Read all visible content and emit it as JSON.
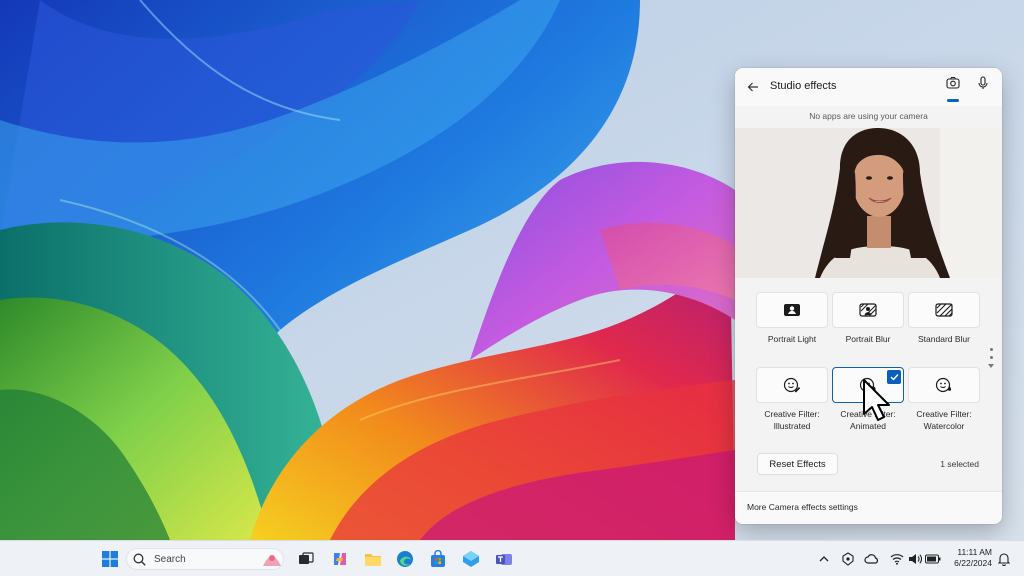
{
  "flyout": {
    "title": "Studio effects",
    "status_text": "No apps are using your camera",
    "tabs": [
      {
        "name": "camera",
        "icon": "camera-icon",
        "active": true
      },
      {
        "name": "microphone",
        "icon": "microphone-icon",
        "active": false
      }
    ],
    "effects": [
      {
        "label": "Portrait Light",
        "icon": "portrait-light-icon",
        "selected": false
      },
      {
        "label": "Portrait Blur",
        "icon": "portrait-blur-icon",
        "selected": false
      },
      {
        "label": "Standard Blur",
        "icon": "standard-blur-icon",
        "selected": false
      },
      {
        "label": "Creative Filter: Illustrated",
        "icon": "illustrated-filter-icon",
        "selected": false
      },
      {
        "label": "Creative Filter: Animated",
        "icon": "animated-filter-icon",
        "selected": true
      },
      {
        "label": "Creative Filter: Watercolor",
        "icon": "watercolor-filter-icon",
        "selected": false
      }
    ],
    "reset_label": "Reset Effects",
    "selected_count": "1 selected",
    "footer_link": "More Camera effects settings"
  },
  "taskbar": {
    "search_placeholder": "Search",
    "pinned_apps": [
      "start-icon",
      "search-icon",
      "task-view-icon",
      "copilot-icon",
      "file-explorer-icon",
      "edge-icon",
      "store-icon",
      "photos-icon",
      "teams-icon"
    ],
    "tray_icons": [
      "chevron-up-icon",
      "security-icon",
      "onedrive-icon",
      "wifi-icon",
      "volume-icon",
      "battery-icon",
      "notification-bell-icon"
    ],
    "time": "11:11 AM",
    "date": "6/22/2024"
  },
  "colors": {
    "accent": "#0a5fb8",
    "flyout_bg": "#f3f3f3",
    "taskbar_bg": "#eef1f5"
  }
}
